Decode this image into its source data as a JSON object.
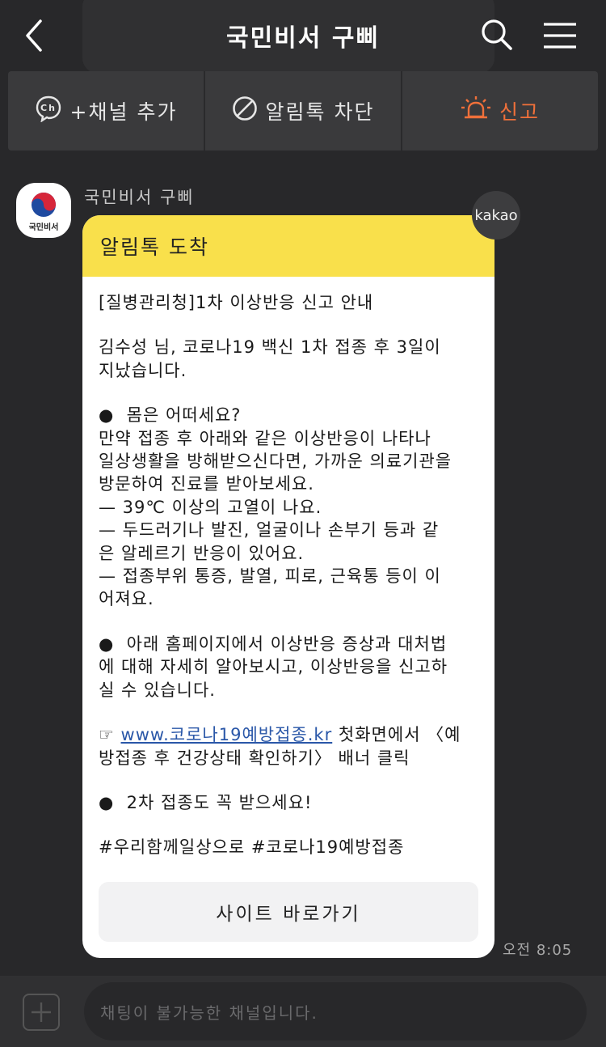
{
  "header": {
    "title": "국민비서 구삐",
    "back_icon": "chevron-left-icon",
    "search_icon": "search-icon",
    "menu_icon": "hamburger-menu-icon"
  },
  "actions": {
    "add_channel": "+채널 추가",
    "block": "알림톡 차단",
    "report": "신고",
    "report_color": "#f0703a"
  },
  "sender": {
    "name": "국민비서 구삐",
    "avatar_caption": "국민비서"
  },
  "message": {
    "header": "알림톡 도착",
    "header_color": "#f9e04b",
    "badge": "kakao",
    "lines": {
      "l1": "[질병관리청]1차 이상반응 신고 안내",
      "l2": "김수성 님, 코로나19 백신 1차 접종 후 3일이\n지났습니다.",
      "l3": "●  몸은 어떠세요?\n만약 접종 후 아래와 같은 이상반응이 나타나\n일상생활을 방해받으신다면, 가까운 의료기관을\n방문하여 진료를 받아보세요.\n— 39℃ 이상의 고열이 나요.\n— 두드러기나 발진, 얼굴이나 손부기 등과 같\n은 알레르기 반응이 있어요.\n— 접종부위 통증, 발열, 피로, 근육통 등이 이\n어져요.",
      "l4": "●  아래 홈페이지에서 이상반응 증상과 대처법\n에 대해 자세히 알아보시고, 이상반응을 신고하\n실 수 있습니다.",
      "l5_prefix": "☞ ",
      "l5_link": "www.코로나19예방접종.kr",
      "l5_rest": " 첫화면에서 〈예\n방접종 후 건강상태 확인하기〉 배너 클릭",
      "l6": "●  2차 접종도 꼭 받으세요!",
      "l7": "#우리함께일상으로 #코로나19예방접종"
    },
    "button": "사이트 바로가기",
    "time": "오전 8:05"
  },
  "input": {
    "placeholder": "채팅이 불가능한 채널입니다."
  }
}
